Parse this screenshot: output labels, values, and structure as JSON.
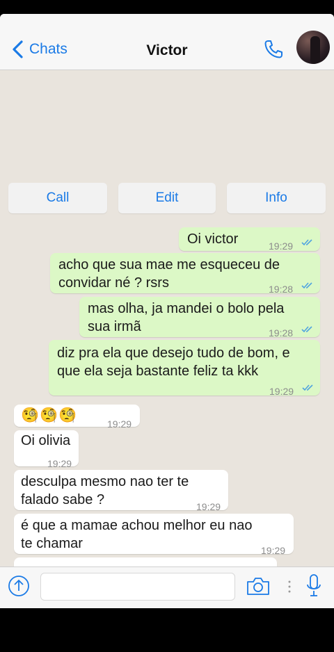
{
  "header": {
    "back_label": "Chats",
    "title": "Victor"
  },
  "actions": {
    "call": "Call",
    "edit": "Edit",
    "info": "Info"
  },
  "messages": [
    {
      "direction": "out",
      "text": "Oi victor",
      "time": "19:29",
      "read": true
    },
    {
      "direction": "out",
      "text_lines": [
        "acho que sua mae me esqueceu de",
        "convidar né ? rsrs"
      ],
      "time": "19:28",
      "read": true
    },
    {
      "direction": "out",
      "text_lines": [
        "mas olha, ja mandei o bolo pela",
        "sua irmã"
      ],
      "time": "19:28",
      "read": true
    },
    {
      "direction": "out",
      "text_lines": [
        "diz pra ela que desejo tudo de bom, e",
        "que ela seja bastante feliz ta kkk"
      ],
      "time": "19:29",
      "read": true
    },
    {
      "direction": "in",
      "emoji": "🧐🧐🧐",
      "time": "19:29"
    },
    {
      "direction": "in",
      "text": "Oi olivia",
      "time": "19:29"
    },
    {
      "direction": "in",
      "text_lines": [
        "desculpa mesmo nao ter te",
        "falado sabe ?"
      ],
      "time": "19:29"
    },
    {
      "direction": "in",
      "text_lines": [
        "é que a mamae achou melhor eu nao",
        "te chamar"
      ],
      "time": "19:29"
    }
  ],
  "composer": {
    "placeholder": ""
  },
  "colors": {
    "accent": "#1a7ae6",
    "outgoing_bubble": "#dcf8c6",
    "incoming_bubble": "#ffffff",
    "chat_background": "#e9e4dd",
    "read_ticks": "#4fa3e0"
  },
  "icons": [
    "chevron-left-icon",
    "phone-icon",
    "double-check-icon",
    "upload-icon",
    "camera-icon",
    "microphone-icon"
  ]
}
